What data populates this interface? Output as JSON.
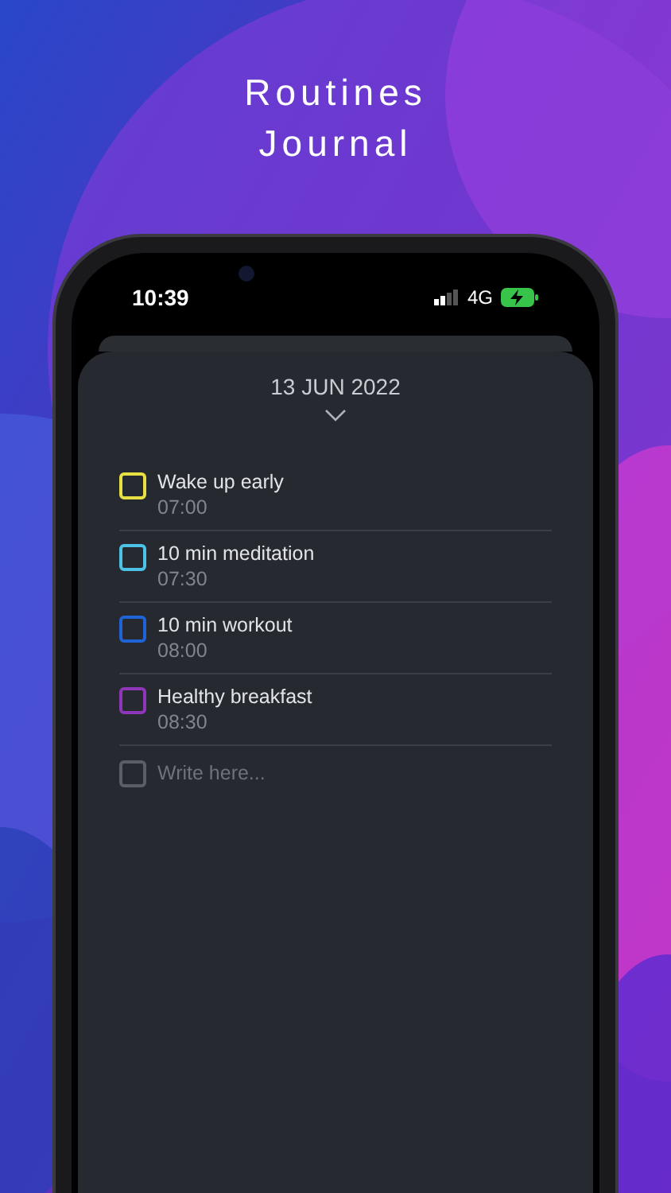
{
  "title_lines": [
    "Routines",
    "Journal"
  ],
  "status_bar": {
    "time": "10:39",
    "network": "4G"
  },
  "date": "13 JUN 2022",
  "tasks": [
    {
      "name": "Wake up early",
      "time": "07:00",
      "checked": false,
      "color": "#e6e043"
    },
    {
      "name": "10 min meditation",
      "time": "07:30",
      "checked": false,
      "color": "#4cc3e6"
    },
    {
      "name": "10 min workout",
      "time": "08:00",
      "checked": false,
      "color": "#1f63d6"
    },
    {
      "name": "Healthy breakfast",
      "time": "08:30",
      "checked": false,
      "color": "#8e36b8"
    }
  ],
  "new_task": {
    "placeholder": "Write here...",
    "checked": false
  }
}
